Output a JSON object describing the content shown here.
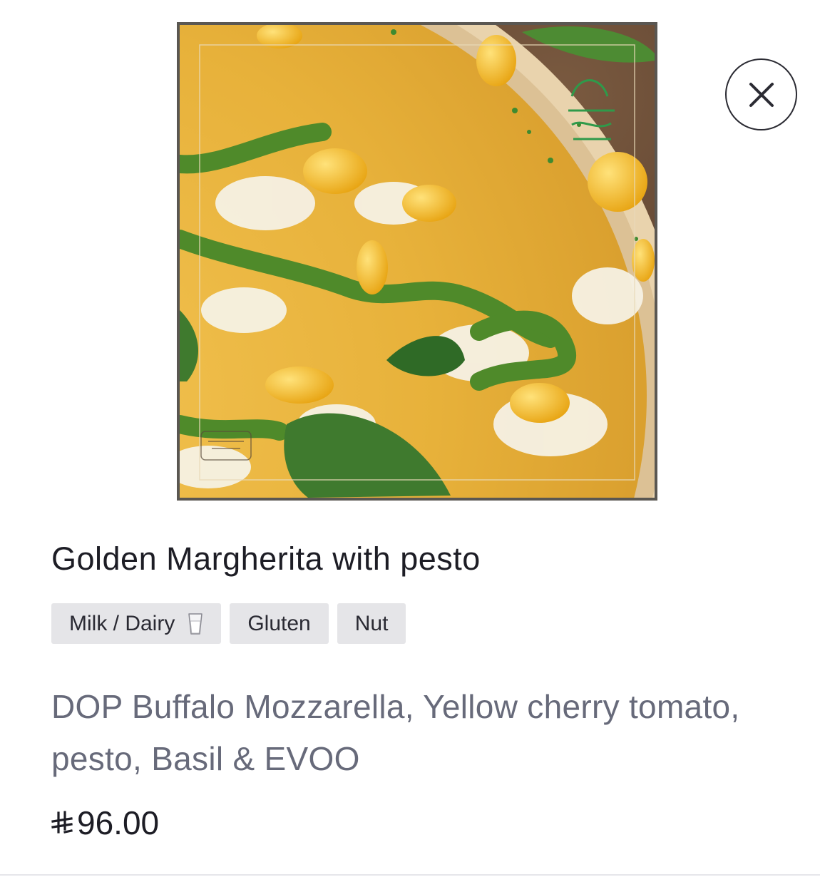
{
  "item": {
    "name": "Golden Margherita with pesto",
    "image_icon": "food-photo",
    "allergens": [
      {
        "label": "Milk / Dairy",
        "icon": "milk-glass-icon"
      },
      {
        "label": "Gluten"
      },
      {
        "label": "Nut"
      }
    ],
    "description": "DOP Buffalo Mozzarella, Yellow cherry tomato, pesto, Basil & EVOO",
    "price": "96.00",
    "currency_icon": "saudi-riyal-icon"
  },
  "close_icon": "close-icon",
  "colors": {
    "title": "#1d1d25",
    "description": "#676a7a",
    "tag_background": "#e5e5e8",
    "close_border": "#2b2b33"
  }
}
